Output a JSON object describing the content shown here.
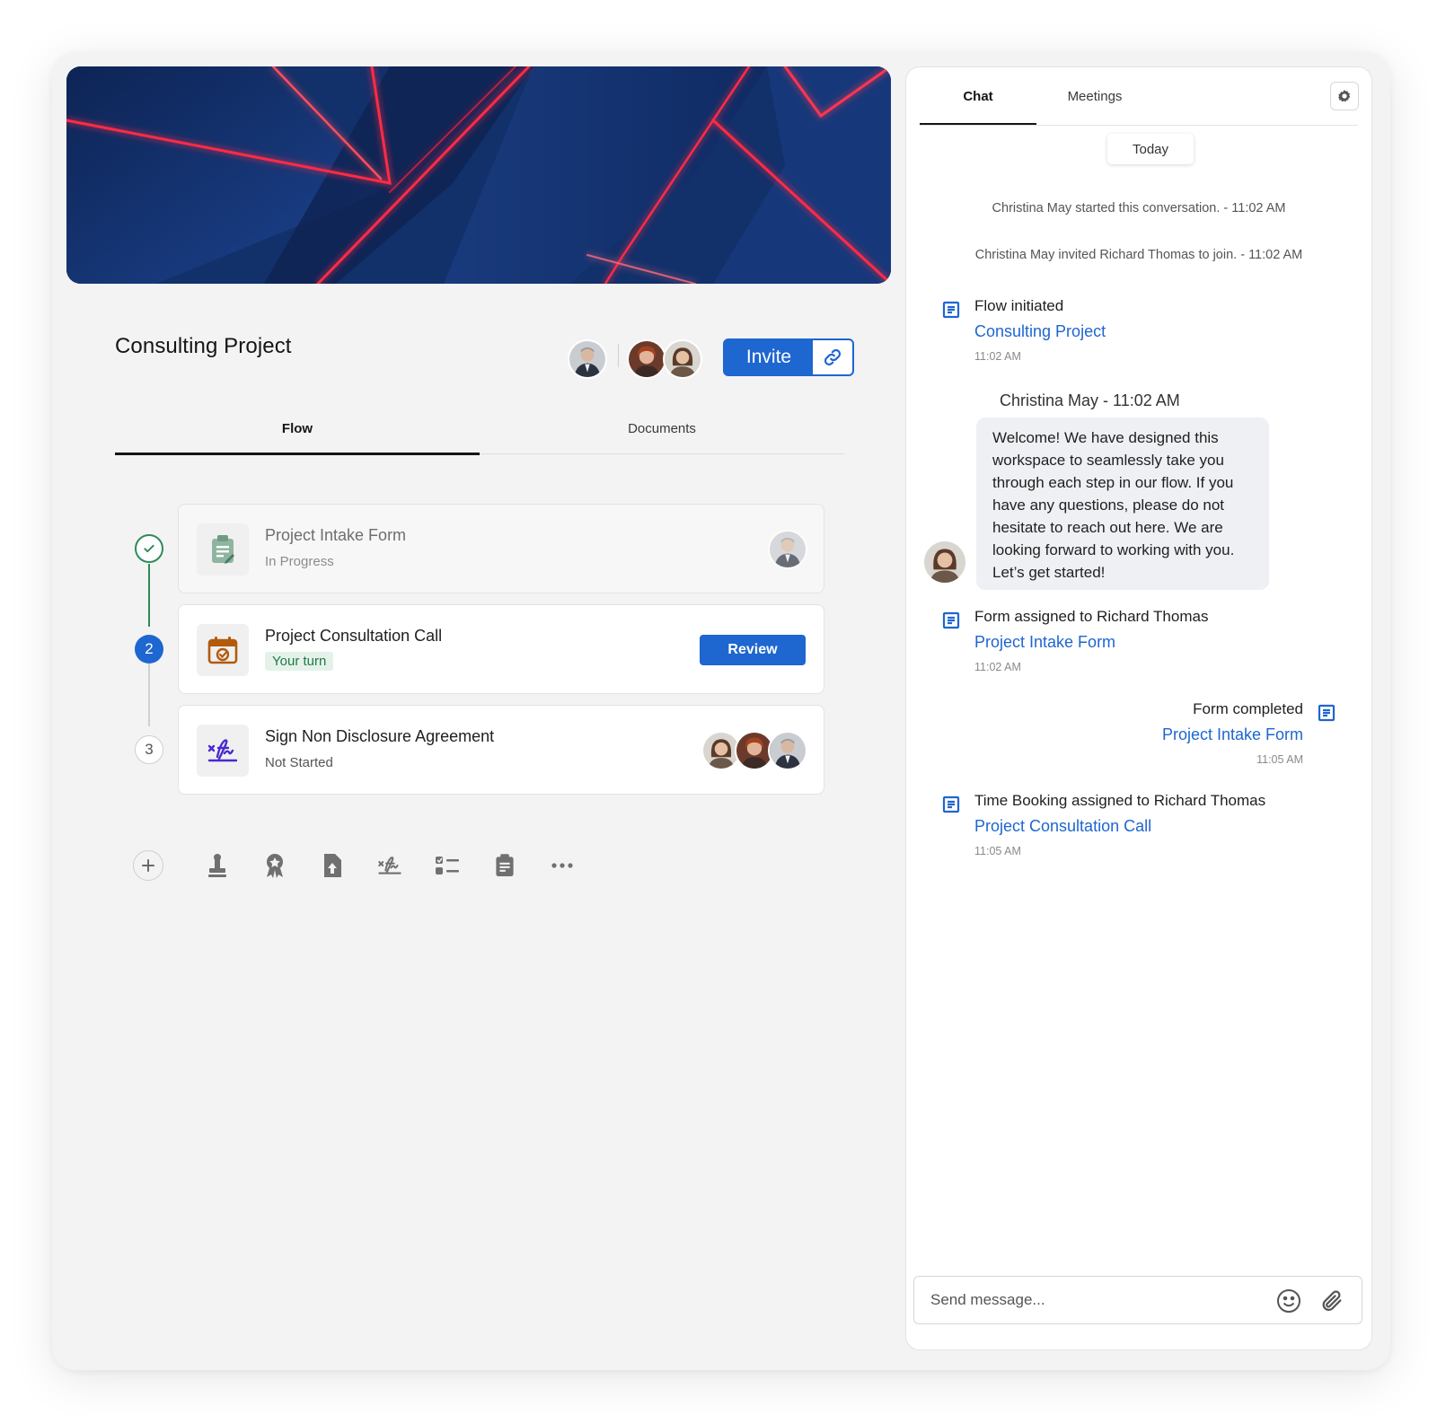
{
  "project": {
    "title": "Consulting Project",
    "invite_label": "Invite"
  },
  "tabs": [
    {
      "label": "Flow",
      "active": true
    },
    {
      "label": "Documents",
      "active": false
    }
  ],
  "steps": [
    {
      "marker": "",
      "name": "Project Intake Form",
      "status": "In Progress",
      "icon": "clipboard-icon"
    },
    {
      "marker": "2",
      "name": "Project Consultation Call",
      "status": "Your turn",
      "action": "Review",
      "icon": "calendar-check-icon"
    },
    {
      "marker": "3",
      "name": "Sign Non Disclosure Agreement",
      "status": "Not Started",
      "icon": "signature-icon"
    }
  ],
  "toolbar": [
    "add-icon",
    "stamp-icon",
    "award-icon",
    "file-upload-icon",
    "signature-icon",
    "checklist-icon",
    "form-icon",
    "more-icon"
  ],
  "chat": {
    "tabs": [
      {
        "label": "Chat",
        "active": true
      },
      {
        "label": "Meetings",
        "active": false
      }
    ],
    "date_pill": "Today",
    "system_messages": [
      "Christina May started this conversation. - 11:02 AM",
      "Christina May invited Richard Thomas  to join. - 11:02 AM"
    ],
    "events": [
      {
        "title": "Flow initiated",
        "link": "Consulting Project",
        "time": "11:02 AM"
      },
      {
        "title": "Form assigned to Richard Thomas",
        "link": "Project Intake Form",
        "time": "11:02 AM"
      },
      {
        "title": "Form completed",
        "link": "Project Intake Form",
        "time": "11:05 AM"
      },
      {
        "title": "Time Booking assigned to Richard Thomas",
        "link": "Project Consultation Call",
        "time": "11:05 AM"
      }
    ],
    "message": {
      "sender": "Christina May - 11:02 AM",
      "text": "Welcome! We have designed this workspace to seamlessly take you through each step in our flow. If you have any questions, please do not hesitate to reach out here. We are looking forward to working with you. Let’s get started!"
    },
    "composer_placeholder": "Send message..."
  },
  "colors": {
    "accent": "#1e66d0",
    "success": "#1c7a47",
    "banner_dark": "#0a1b40",
    "neon": "#ff2a44"
  }
}
